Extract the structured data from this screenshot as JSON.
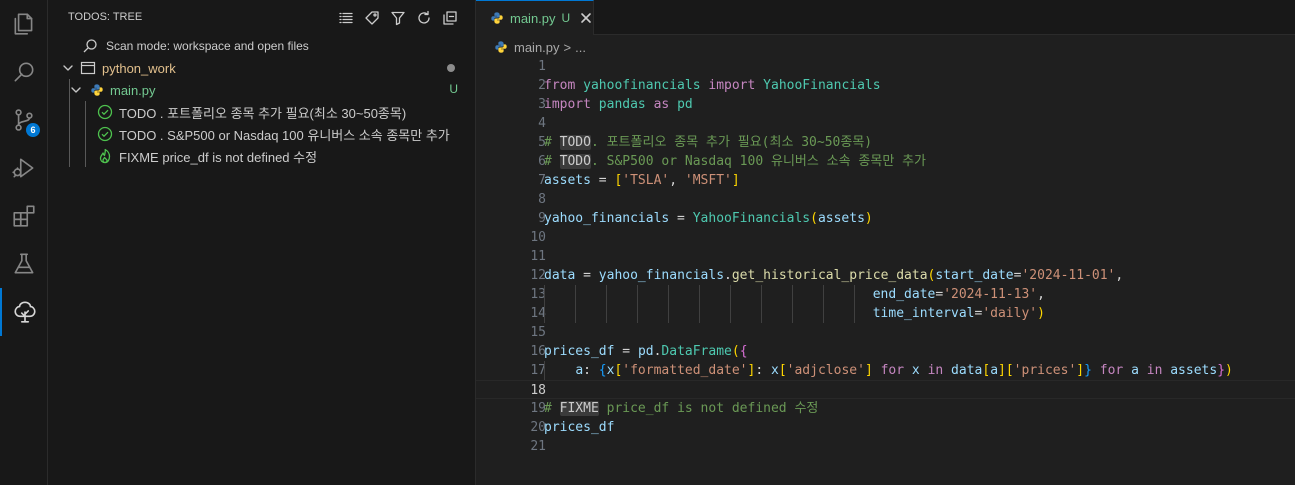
{
  "activity_bar": {
    "items": [
      {
        "name": "explorer-icon"
      },
      {
        "name": "search-icon"
      },
      {
        "name": "source-control-icon",
        "badge": "6"
      },
      {
        "name": "run-debug-icon"
      },
      {
        "name": "extensions-icon"
      },
      {
        "name": "testing-icon"
      },
      {
        "name": "todo-tree-icon",
        "active": true
      }
    ]
  },
  "sidebar": {
    "title": "TODOS: TREE",
    "actions": [
      "list-view-icon",
      "tag-icon",
      "filter-icon",
      "refresh-icon",
      "collapse-all-icon"
    ],
    "scan_mode": "Scan mode: workspace and open files",
    "folder": {
      "label": "python_work"
    },
    "file": {
      "label": "main.py",
      "status": "U"
    },
    "items": [
      {
        "label": "TODO . 포트폴리오 종목 추가 필요(최소 30~50종목)",
        "icon": "check-circle-icon"
      },
      {
        "label": "TODO . S&P500 or Nasdaq 100 유니버스 소속 종목만 추가",
        "icon": "check-circle-icon"
      },
      {
        "label": "FIXME price_df is not defined 수정",
        "icon": "flame-icon"
      }
    ]
  },
  "editor": {
    "tab": {
      "label": "main.py",
      "status": "U"
    },
    "breadcrumb": {
      "file": "main.py",
      "sep": ">",
      "rest": "..."
    },
    "line_numbers": [
      "1",
      "2",
      "3",
      "4",
      "5",
      "6",
      "7",
      "8",
      "9",
      "10",
      "11",
      "12",
      "13",
      "14",
      "15",
      "16",
      "17",
      "18",
      "19",
      "20",
      "21"
    ],
    "current_line": "18",
    "code": {
      "l2": [
        "from",
        " ",
        "yahoofinancials",
        " ",
        "import",
        " ",
        "YahooFinancials"
      ],
      "l3": [
        "import",
        " ",
        "pandas",
        " ",
        "as",
        " ",
        "pd"
      ],
      "l5": [
        "# ",
        "TODO",
        ". 포트폴리오 종목 추가 필요(최소 30~50종목)"
      ],
      "l6": [
        "# ",
        "TODO",
        ". S&P500 or Nasdaq 100 유니버스 소속 종목만 추가"
      ],
      "l7": [
        "assets",
        " = ",
        "[",
        "'TSLA'",
        ", ",
        "'MSFT'",
        "]"
      ],
      "l9": [
        "yahoo_financials",
        " = ",
        "YahooFinancials",
        "(",
        "assets",
        ")"
      ],
      "l12": [
        "data",
        " = ",
        "yahoo_financials",
        ".",
        "get_historical_price_data",
        "(",
        "start_date",
        "=",
        "'2024-11-01'",
        ","
      ],
      "l13": [
        "                                          ",
        "end_date",
        "=",
        "'2024-11-13'",
        ","
      ],
      "l14": [
        "                                          ",
        "time_interval",
        "=",
        "'daily'",
        ")"
      ],
      "l16": [
        "prices_df",
        " = ",
        "pd",
        ".",
        "DataFrame",
        "(",
        "{"
      ],
      "l17": [
        "    ",
        "a",
        ": ",
        "{",
        "x",
        "[",
        "'formatted_date'",
        "]",
        ": ",
        "x",
        "[",
        "'adjclose'",
        "]",
        " ",
        "for",
        " ",
        "x",
        " ",
        "in",
        " ",
        "data",
        "[",
        "a",
        "]",
        "[",
        "'prices'",
        "]",
        "}",
        " ",
        "for",
        " ",
        "a",
        " ",
        "in",
        " ",
        "assets",
        "}",
        ")"
      ],
      "l19": [
        "# ",
        "FIXME",
        " price_df is not defined 수정"
      ],
      "l20": [
        "prices_df"
      ]
    }
  }
}
